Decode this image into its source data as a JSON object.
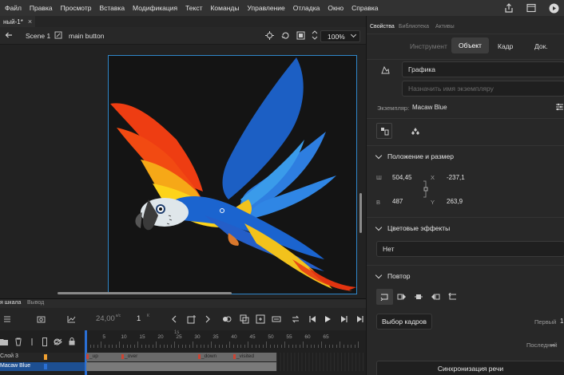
{
  "menu": [
    "Файл",
    "Правка",
    "Просмотр",
    "Вставка",
    "Модификация",
    "Текст",
    "Команды",
    "Управление",
    "Отладка",
    "Окно",
    "Справка"
  ],
  "document": {
    "tab_title": "ный-1*",
    "close": "×"
  },
  "editbar": {
    "scene": "Scene 1",
    "symbol": "main button",
    "zoom": "100%"
  },
  "timeline": {
    "tabs": [
      "я шкала",
      "Вывод"
    ],
    "fps": "24,00",
    "fps_unit": "к/с",
    "frame": "1",
    "frame_unit": "К",
    "ruler_marker": "1s",
    "ruler": [
      "5",
      "10",
      "15",
      "20",
      "25",
      "30",
      "35",
      "40",
      "45",
      "50",
      "55",
      "60",
      "65"
    ],
    "layers": [
      {
        "name": "Слой 3",
        "color": "#f0a030"
      },
      {
        "name": "Macaw Blue",
        "color": "#2a6fd4"
      }
    ],
    "keyframe_labels": [
      "_up",
      "_over",
      "_down",
      "_visited"
    ]
  },
  "panel": {
    "tabs": [
      "Свойства",
      "Библиотека",
      "Активы"
    ],
    "mode_tabs": [
      "Инструмент",
      "Объект",
      "Кадр",
      "Док."
    ],
    "active_mode": "Объект",
    "symbol_type": "Графика",
    "instance_name_placeholder": "Назначить имя экземпляру",
    "instance_label": "Экземпляр:",
    "instance_value": "Macaw Blue",
    "position": {
      "title": "Положение и размер",
      "w_label": "Ш",
      "w": "504,45",
      "x_label": "X",
      "x": "-237,1",
      "h_label": "В",
      "h": "487",
      "y_label": "Y",
      "y": "263,9"
    },
    "color_effects": {
      "title": "Цветовые эффекты",
      "value": "Нет"
    },
    "loop": {
      "title": "Повтор",
      "frame_picker": "Выбор кадров",
      "first_label": "Первый",
      "first_value": "1",
      "last_label": "Последний",
      "sync_button": "Синхронизация речи"
    }
  },
  "colors": {
    "accent_blue": "#2f86c9",
    "playhead": "#2a6fd4"
  }
}
